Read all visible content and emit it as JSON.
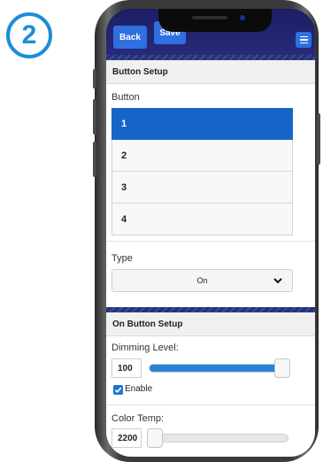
{
  "step_badge": "2",
  "toolbar": {
    "back_label": "Back",
    "save_label": "Save",
    "menu_icon": "hamburger-menu-icon"
  },
  "button_setup": {
    "header": "Button Setup",
    "button_label": "Button",
    "buttons": [
      "1",
      "2",
      "3",
      "4"
    ],
    "selected_button": "1",
    "type_label": "Type",
    "type_value": "On"
  },
  "on_button_setup": {
    "header": "On Button Setup",
    "dimming_label": "Dimming Level:",
    "dimming_value": "100",
    "dimming_fraction": 1.0,
    "enable_label": "Enable",
    "enable_checked": true,
    "color_temp_label": "Color Temp:",
    "color_temp_value": "2200",
    "color_temp_fraction": 0.0
  },
  "colors": {
    "accent": "#1b8fd6",
    "selected": "#1565c8",
    "slider": "#2b83d8",
    "navbar": "#1c1f63"
  }
}
